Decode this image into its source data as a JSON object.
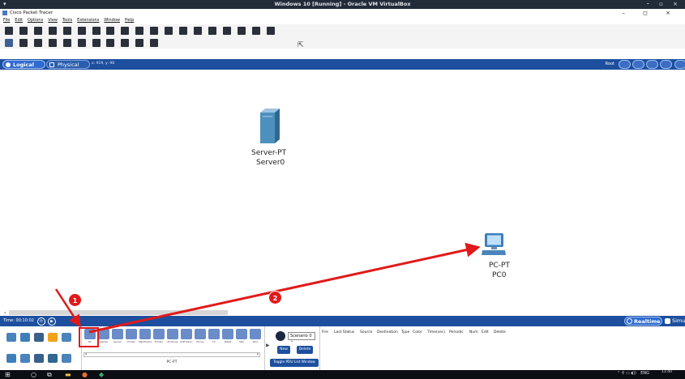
{
  "vbox": {
    "title": "Windows 10 [Running] - Oracle VM VirtualBox",
    "menu_glyph": "▾",
    "controls": "⁃ ▫ ×"
  },
  "app": {
    "title": "Cisco Packet Tracer",
    "window_controls": "–  ◻  ×"
  },
  "menu": [
    "File",
    "Edit",
    "Options",
    "View",
    "Tools",
    "Extensions",
    "Window",
    "Help"
  ],
  "modebar": {
    "logical": "Logical",
    "physical": "Physical",
    "coords": "x: 919, y: 98",
    "root": "Root"
  },
  "devices": [
    {
      "type": "Server-PT",
      "name": "Server0",
      "icon": "server-icon"
    },
    {
      "type": "PC-PT",
      "name": "PC0",
      "icon": "pc-icon"
    }
  ],
  "timebar": {
    "time": "Time: 00:10:02",
    "realtime": "Realtime",
    "simulation": "Simulation"
  },
  "device_palette": {
    "items": [
      "PC",
      "Laptop",
      "Server",
      "Printer",
      "Mainframe",
      "Printer",
      "IP Phone",
      "VoIP Device",
      "Phone",
      "TV",
      "Tablet",
      "SDA",
      "Wire"
    ],
    "caption": "PC-PT"
  },
  "scenario": {
    "select": "Scenario 0",
    "new": "New",
    "delete": "Delete",
    "toggle": "Toggle PDU List Window"
  },
  "pdu_headers": [
    "Fire",
    "Last Status",
    "Source",
    "Destination",
    "Type",
    "Color",
    "Time(sec)",
    "Periodic",
    "Num",
    "Edit",
    "Delete"
  ],
  "taskbar": {
    "time": "11:40",
    "lang": "ENG"
  },
  "annotations": {
    "step1": "1",
    "step2": "2",
    "color": "#e01a1a"
  }
}
